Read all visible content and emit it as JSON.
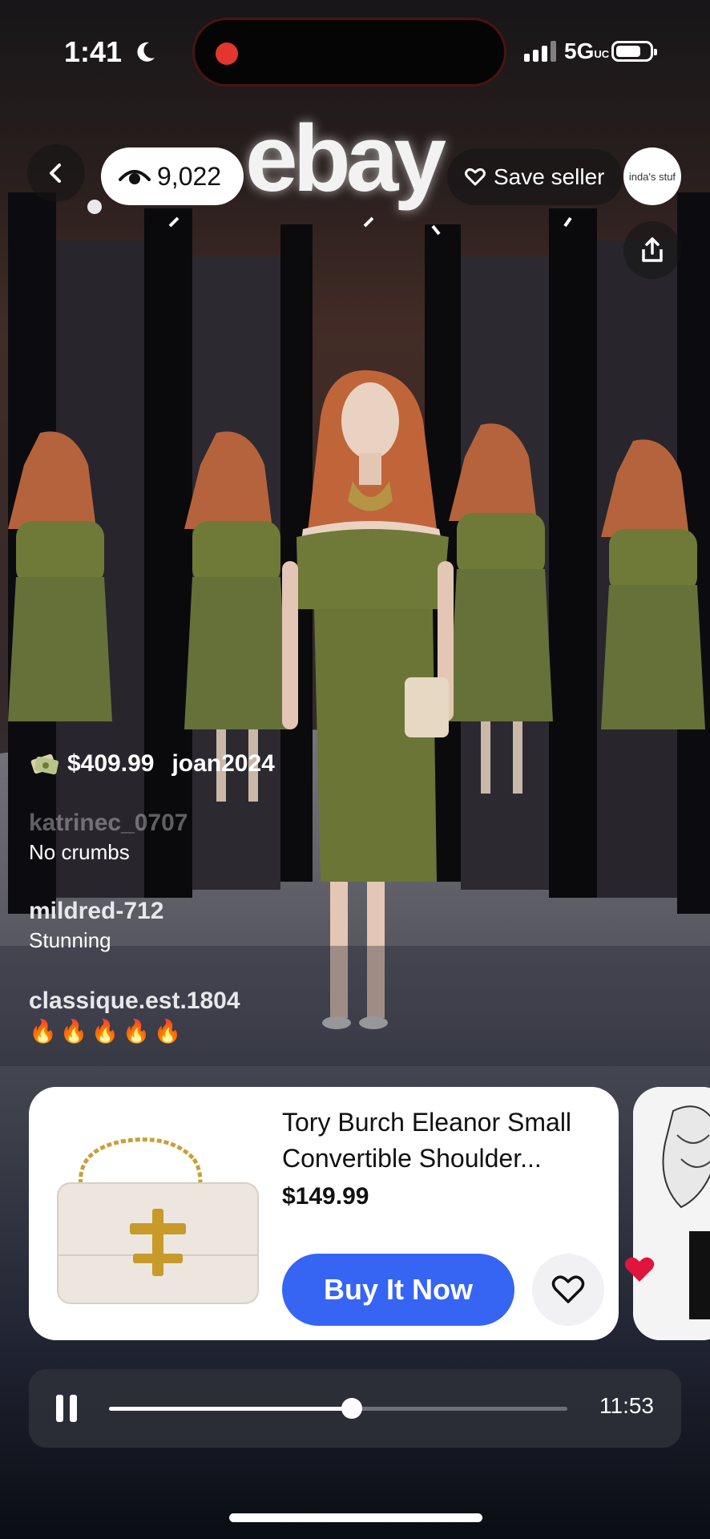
{
  "status_bar": {
    "time": "1:41",
    "network": "5G",
    "network_sub": "UC"
  },
  "header": {
    "viewer_count": "9,022",
    "logo_text": "ebay",
    "save_seller_label": "Save seller",
    "seller_avatar_text": "inda's stuf"
  },
  "bid": {
    "amount": "$409.99",
    "user": "joan2024"
  },
  "chat": [
    {
      "user": "katrinec_0707",
      "text": "No crumbs"
    },
    {
      "user": "mildred-712",
      "text": "Stunning"
    },
    {
      "user": "classique.est.1804",
      "text": "🔥🔥🔥🔥🔥"
    }
  ],
  "product": {
    "title": "Tory Burch Eleanor Small Convertible Shoulder...",
    "price": "$149.99",
    "buy_label": "Buy It Now"
  },
  "player": {
    "elapsed_fraction": 0.53,
    "time_remaining": "11:53"
  },
  "colors": {
    "accent": "#3665f3",
    "heart": "#e0143c",
    "dress": "#6f7a38",
    "hair": "#c0643a"
  }
}
